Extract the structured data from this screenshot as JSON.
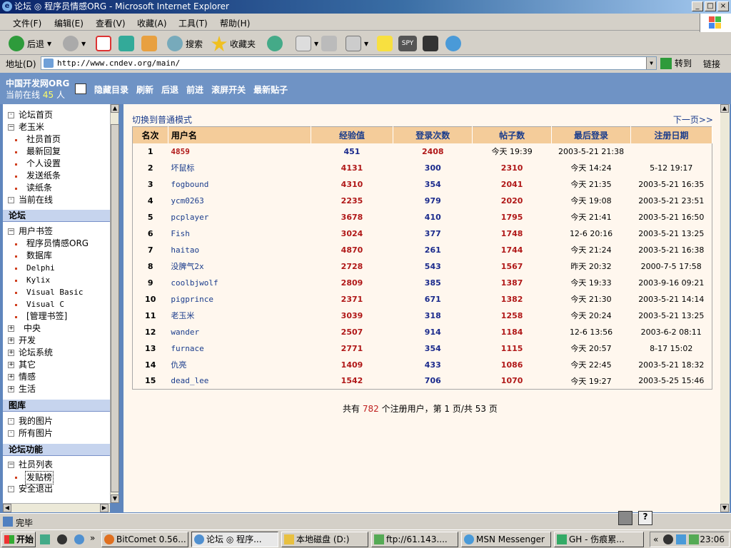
{
  "window": {
    "title": "论坛 ◎ 程序员情感ORG - Microsoft Internet Explorer"
  },
  "menu": [
    "文件(F)",
    "编辑(E)",
    "查看(V)",
    "收藏(A)",
    "工具(T)",
    "帮助(H)"
  ],
  "toolbar": {
    "back": "后退",
    "search": "搜索",
    "favorites": "收藏夹"
  },
  "address": {
    "label": "地址(D)",
    "url": "http://www.cndev.org/main/",
    "go": "转到",
    "links": "链接"
  },
  "header": {
    "site": "中国开发网ORG",
    "online_label": "当前在线",
    "online_count": "45",
    "online_unit": "人",
    "nav": [
      "隐藏目录",
      "刷新",
      "后退",
      "前进",
      "滚屏开关",
      "最新贴子"
    ]
  },
  "sidebar": {
    "top": [
      "论坛首页",
      "老玉米",
      "社员首页",
      "最新回复",
      "个人设置",
      "发送纸条",
      "读纸条",
      "当前在线"
    ],
    "sec_forum": "论坛",
    "bookmarks": "用户书签",
    "bookmark_items": [
      "程序员情感ORG",
      "数据库",
      "Delphi",
      "Kylix",
      "Visual Basic",
      "Visual C",
      "[管理书签]"
    ],
    "groups": [
      "中央",
      "开发",
      "论坛系统",
      "其它",
      "情感",
      "生活"
    ],
    "sec_gallery": "图库",
    "gallery": [
      "我的图片",
      "所有图片"
    ],
    "sec_func": "论坛功能",
    "func": [
      "社员列表",
      "发贴榜",
      "安全退出"
    ]
  },
  "main": {
    "switch_mode": "切换到普通模式",
    "next_page": "下一页>>",
    "columns": [
      "名次",
      "用户名",
      "经验值",
      "登录次数",
      "帖子数",
      "最后登录",
      "注册日期"
    ],
    "rows": [
      [
        "1",
        "4859",
        "451",
        "2408",
        "今天 19:39",
        "2003-5-21 21:38",
        ""
      ],
      [
        "2",
        "坏鼠标",
        "4131",
        "300",
        "2310",
        "今天 14:24",
        "5-12 19:17"
      ],
      [
        "3",
        "fogbound",
        "4310",
        "354",
        "2041",
        "今天 21:35",
        "2003-5-21 16:35"
      ],
      [
        "4",
        "ycm0263",
        "2235",
        "979",
        "2020",
        "今天 19:08",
        "2003-5-21 23:51"
      ],
      [
        "5",
        "pcplayer",
        "3678",
        "410",
        "1795",
        "今天 21:41",
        "2003-5-21 16:50"
      ],
      [
        "6",
        "Fish",
        "3024",
        "377",
        "1748",
        "12-6 20:16",
        "2003-5-21 13:25"
      ],
      [
        "7",
        "haitao",
        "4870",
        "261",
        "1744",
        "今天 21:24",
        "2003-5-21 16:38"
      ],
      [
        "8",
        "没脾气2x",
        "2728",
        "543",
        "1567",
        "昨天 20:32",
        "2000-7-5 17:58"
      ],
      [
        "9",
        "coolbjwolf",
        "2809",
        "385",
        "1387",
        "今天 19:33",
        "2003-9-16 09:21"
      ],
      [
        "10",
        "pigprince",
        "2371",
        "671",
        "1382",
        "今天 21:30",
        "2003-5-21 14:14"
      ],
      [
        "11",
        "老玉米",
        "3039",
        "318",
        "1258",
        "今天 20:24",
        "2003-5-21 13:25"
      ],
      [
        "12",
        "wander",
        "2507",
        "914",
        "1184",
        "12-6 13:56",
        "2003-6-2 08:11"
      ],
      [
        "13",
        "furnace",
        "2771",
        "354",
        "1115",
        "今天 20:57",
        "8-17 15:02"
      ],
      [
        "14",
        "仇亮",
        "1409",
        "433",
        "1086",
        "今天 22:45",
        "2003-5-21 18:32"
      ],
      [
        "15",
        "dead_lee",
        "1542",
        "706",
        "1070",
        "今天 19:27",
        "2003-5-25 15:46"
      ]
    ],
    "summary_pre": "共有",
    "total_users": "782",
    "summary_mid": "个注册用户，第",
    "page": "1",
    "summary_sep": "页/共",
    "pages": "53",
    "summary_end": "页"
  },
  "status": {
    "text": "完毕"
  },
  "taskbar": {
    "start": "开始",
    "tasks": [
      "BitComet 0.56...",
      "论坛 ◎ 程序...",
      "本地磁盘 (D:)",
      "ftp://61.143....",
      "MSN Messenger",
      "GH - 伤痕累..."
    ],
    "clock": "23:06"
  }
}
